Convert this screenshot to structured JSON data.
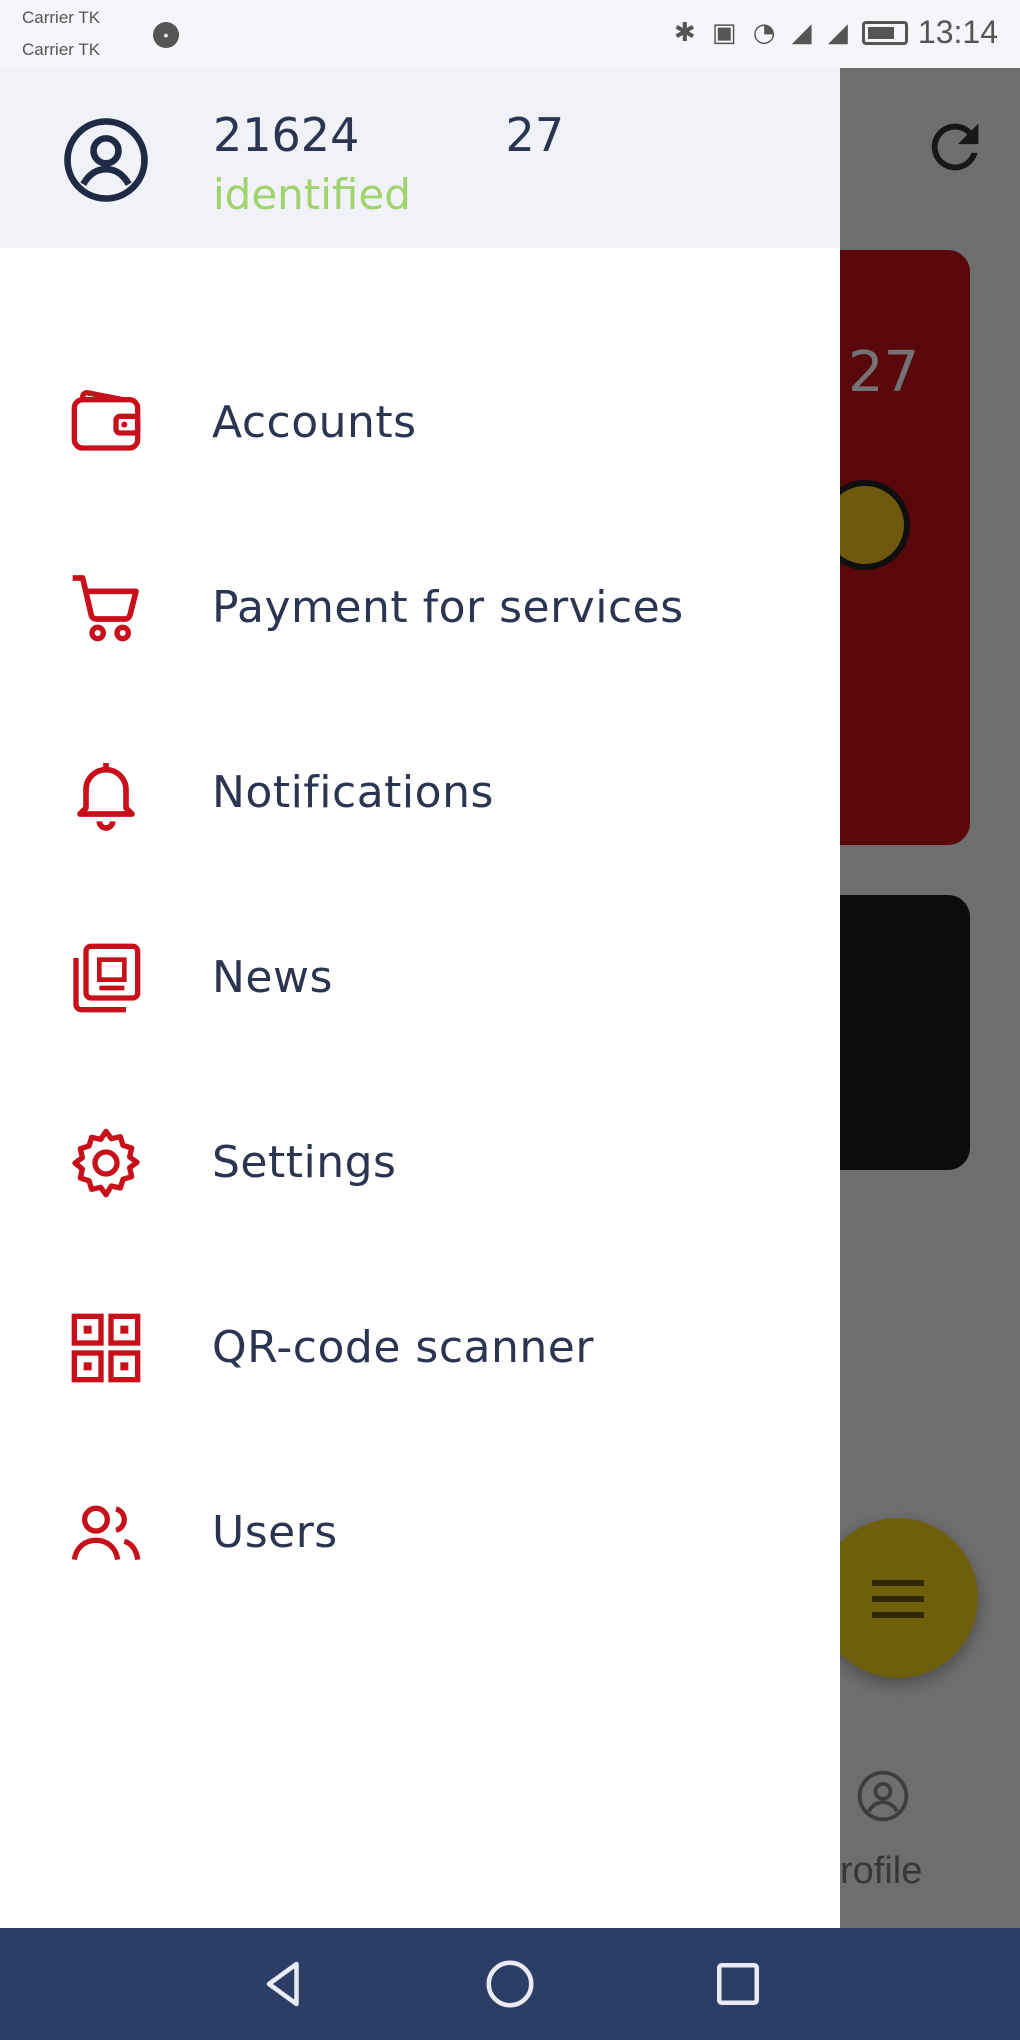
{
  "status_bar": {
    "carrier_1": "Carrier TK",
    "carrier_2": "Carrier TK",
    "time": "13:14",
    "icons": [
      "bluetooth-icon",
      "vibrate-icon",
      "wifi-icon",
      "signal-icon",
      "signal-icon",
      "battery-icon"
    ]
  },
  "drawer": {
    "user_number": "21624          27",
    "user_status": "identified",
    "menu": [
      {
        "label": "Accounts",
        "icon": "wallet-icon"
      },
      {
        "label": "Payment for services",
        "icon": "cart-icon"
      },
      {
        "label": "Notifications",
        "icon": "bell-icon"
      },
      {
        "label": "News",
        "icon": "newspaper-icon"
      },
      {
        "label": "Settings",
        "icon": "gear-icon"
      },
      {
        "label": "QR-code scanner",
        "icon": "qr-code-icon"
      },
      {
        "label": "Users",
        "icon": "users-icon"
      }
    ]
  },
  "background": {
    "card_number": "27",
    "profile_label": "rofile"
  },
  "colors": {
    "accent": "#c8101a",
    "text": "#2b3552",
    "status_ok": "#9fd36b",
    "nav_bar": "#2c3d66",
    "fab": "#f4d31d"
  }
}
